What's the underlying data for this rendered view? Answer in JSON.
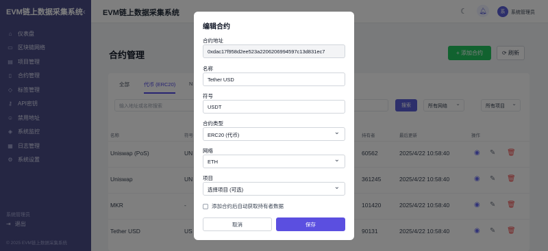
{
  "sidebar": {
    "title": "EVM链上数据采集系统",
    "collapse_icon": "‹",
    "items": [
      {
        "icon": "⌂",
        "label": "仪表盘"
      },
      {
        "icon": "▭",
        "label": "区块链网络"
      },
      {
        "icon": "▤",
        "label": "项目管理"
      },
      {
        "icon": "▯",
        "label": "合约管理"
      },
      {
        "icon": "◇",
        "label": "标签管理"
      },
      {
        "icon": "⚷",
        "label": "API密钥"
      },
      {
        "icon": "☺",
        "label": "禁用地址"
      },
      {
        "icon": "◈",
        "label": "系统监控"
      },
      {
        "icon": "▦",
        "label": "日志管理"
      },
      {
        "icon": "⚙",
        "label": "系统设置"
      }
    ],
    "user": "系统管理员",
    "logout": "退出",
    "copyright": "© 2025 EVM链上数据采集系统"
  },
  "topbar": {
    "title": "EVM链上数据采集系统",
    "avatar_text": "系",
    "user": "系统管理员"
  },
  "main": {
    "page_title": "合约管理",
    "add_button": "+ 添加合约",
    "refresh_button": "⟳ 刷新",
    "tabs": [
      {
        "label": "全部"
      },
      {
        "label": "代币 (ERC20)"
      },
      {
        "label": "N"
      }
    ],
    "search_placeholder": "输入地址或名称搜索",
    "search_button": "搜索",
    "network_filter": "所有网络",
    "project_filter": "所有项目",
    "headers": [
      "名称",
      "符号",
      "持有者",
      "最后更新",
      "操作"
    ],
    "rows": [
      {
        "name": "Uniswap (PoS)",
        "symbol": "UN",
        "holders": "60562",
        "updated": "2025/4/22 10:58:40"
      },
      {
        "name": "Uniswap",
        "symbol": "UN",
        "holders": "361245",
        "updated": "2025/4/22 10:58:40"
      },
      {
        "name": "MKR",
        "symbol": "-",
        "holders": "101420",
        "updated": "2025/4/22 10:58:40"
      },
      {
        "name": "Tether USD",
        "symbol": "US",
        "holders": "90131",
        "updated": "2025/4/22 10:58:40"
      }
    ]
  },
  "modal": {
    "title": "编辑合约",
    "address_label": "合约地址",
    "address_value": "0xdac17f958d2ee523a2206206994597c13d831ec7",
    "name_label": "名称",
    "name_value": "Tether USD",
    "symbol_label": "符号",
    "symbol_value": "USDT",
    "type_label": "合约类型",
    "type_value": "ERC20 (代币)",
    "network_label": "网络",
    "network_value": "ETH",
    "project_label": "项目",
    "project_value": "选择项目 (可选)",
    "auto_fetch_label": "添加合约后自动获取持有者数据",
    "cancel": "取消",
    "save": "保存"
  },
  "colors": {
    "sidebar_bg": "#4a4d86",
    "accent": "#5b4fe0",
    "add_green": "#22c55e"
  }
}
